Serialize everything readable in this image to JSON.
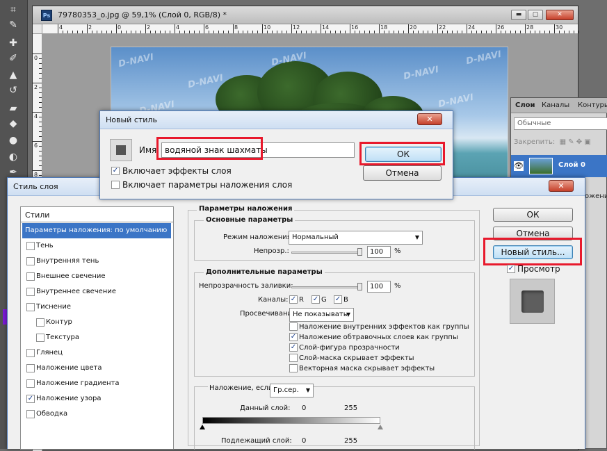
{
  "toolbox": {
    "tools": [
      "crop-tool",
      "eyedropper-tool",
      "healing-brush-tool",
      "brush-tool",
      "clone-stamp-tool",
      "history-brush-tool",
      "eraser-tool",
      "paint-bucket-tool",
      "blur-tool",
      "dodge-tool",
      "pen-tool"
    ]
  },
  "document": {
    "app_icon": "Ps",
    "title": "79780353_o.jpg @ 59,1% (Слой 0, RGB/8) *",
    "ruler_top": [
      "4",
      "2",
      "0",
      "2",
      "4",
      "6",
      "8",
      "10",
      "12",
      "14",
      "16",
      "18",
      "20",
      "22",
      "24",
      "26",
      "28",
      "30"
    ],
    "ruler_left": [
      "0",
      "2",
      "4",
      "6",
      "8"
    ],
    "watermark": "D-NAVI"
  },
  "layers_panel": {
    "tabs": [
      "Слои",
      "Каналы",
      "Контуры"
    ],
    "blend_mode": "Обычные",
    "lock_label": "Закрепить:",
    "layer_name": "Слой 0",
    "side_text": "ожение"
  },
  "new_style_dialog": {
    "title": "Новый стиль",
    "name_label": "Имя:",
    "name_value": "водяной знак шахматы",
    "ok": "ОК",
    "cancel": "Отмена",
    "include_effects": "Включает эффекты слоя",
    "include_effects_checked": true,
    "include_blending": "Включает параметры наложения слоя",
    "include_blending_checked": false,
    "close": "✕"
  },
  "layer_style_dialog": {
    "title": "Стиль слоя",
    "close": "✕",
    "styles_header": "Стили",
    "styles": [
      {
        "label": "Параметры наложения: по умолчанию",
        "selected": true,
        "checkbox": false
      },
      {
        "label": "Тень",
        "checked": false
      },
      {
        "label": "Внутренняя тень",
        "checked": false
      },
      {
        "label": "Внешнее свечение",
        "checked": false
      },
      {
        "label": "Внутреннее свечение",
        "checked": false
      },
      {
        "label": "Тиснение",
        "checked": false
      },
      {
        "label": "Контур",
        "checked": false,
        "indent": true
      },
      {
        "label": "Текстура",
        "checked": false,
        "indent": true
      },
      {
        "label": "Глянец",
        "checked": false
      },
      {
        "label": "Наложение цвета",
        "checked": false
      },
      {
        "label": "Наложение градиента",
        "checked": false
      },
      {
        "label": "Наложение узора",
        "checked": true
      },
      {
        "label": "Обводка",
        "checked": false
      }
    ],
    "blending_options": "Параметры наложения",
    "general": "Основные параметры",
    "blend_mode_label": "Режим наложения:",
    "blend_mode_value": "Нормальный",
    "opacity_label": "Непрозр.:",
    "opacity_value": "100",
    "percent": "%",
    "advanced": "Дополнительные параметры",
    "fill_opacity_label": "Непрозрачность заливки:",
    "fill_opacity_value": "100",
    "channels_label": "Каналы:",
    "channels": [
      "R",
      "G",
      "B"
    ],
    "knockout_label": "Просвечивание:",
    "knockout_value": "Не показывать",
    "adv_checks": [
      {
        "label": "Наложение внутренних эффектов как группы",
        "checked": false
      },
      {
        "label": "Наложение обтравочных слоев как группы",
        "checked": true
      },
      {
        "label": "Слой-фигура прозрачности",
        "checked": true
      },
      {
        "label": "Слой-маска скрывает эффекты",
        "checked": false
      },
      {
        "label": "Векторная маска скрывает эффекты",
        "checked": false
      }
    ],
    "blend_if_label": "Наложение, если:",
    "blend_if_value": "Гр.сер.",
    "this_layer_label": "Данный слой:",
    "this_layer_min": "0",
    "this_layer_max": "255",
    "underlying_label": "Подлежащий слой:",
    "underlying_min": "0",
    "underlying_max": "255",
    "ok": "ОК",
    "cancel": "Отмена",
    "new_style": "Новый стиль...",
    "preview_label": "Просмотр",
    "preview_checked": true
  },
  "colors": {
    "highlight": "#e8192c",
    "selection": "#3b75c6"
  }
}
